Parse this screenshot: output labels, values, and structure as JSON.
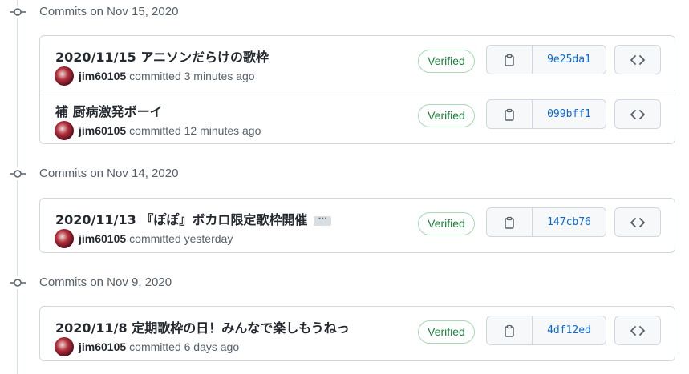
{
  "groups": [
    {
      "title": "Commits on Nov 15, 2020",
      "commits": [
        {
          "message": "2020/11/15 アニソンだらけの歌枠",
          "author": "jim60105",
          "time": "committed 3 minutes ago",
          "badge": "Verified",
          "sha": "9e25da1"
        },
        {
          "message": "補 厨病激発ボーイ",
          "author": "jim60105",
          "time": "committed 12 minutes ago",
          "badge": "Verified",
          "sha": "099bff1"
        }
      ]
    },
    {
      "title": "Commits on Nov 14, 2020",
      "commits": [
        {
          "message": "2020/11/13 『ぽぽ』ボカロ限定歌枠開催",
          "author": "jim60105",
          "time": "committed yesterday",
          "badge": "Verified",
          "sha": "147cb76",
          "ellipsis": "···"
        }
      ]
    },
    {
      "title": "Commits on Nov 9, 2020",
      "commits": [
        {
          "message": "2020/11/8 定期歌枠の日！みんなで楽しもうねっ",
          "author": "jim60105",
          "time": "committed 6 days ago",
          "badge": "Verified",
          "sha": "4df12ed"
        }
      ]
    }
  ],
  "icons": {
    "timeline_node": "git-commit-icon",
    "copy": "clipboard-icon",
    "browse": "code-icon"
  },
  "colors": {
    "verified": "#1a7f37",
    "sha": "#0969da",
    "meta": "#57606a",
    "border": "#d0d7de"
  }
}
